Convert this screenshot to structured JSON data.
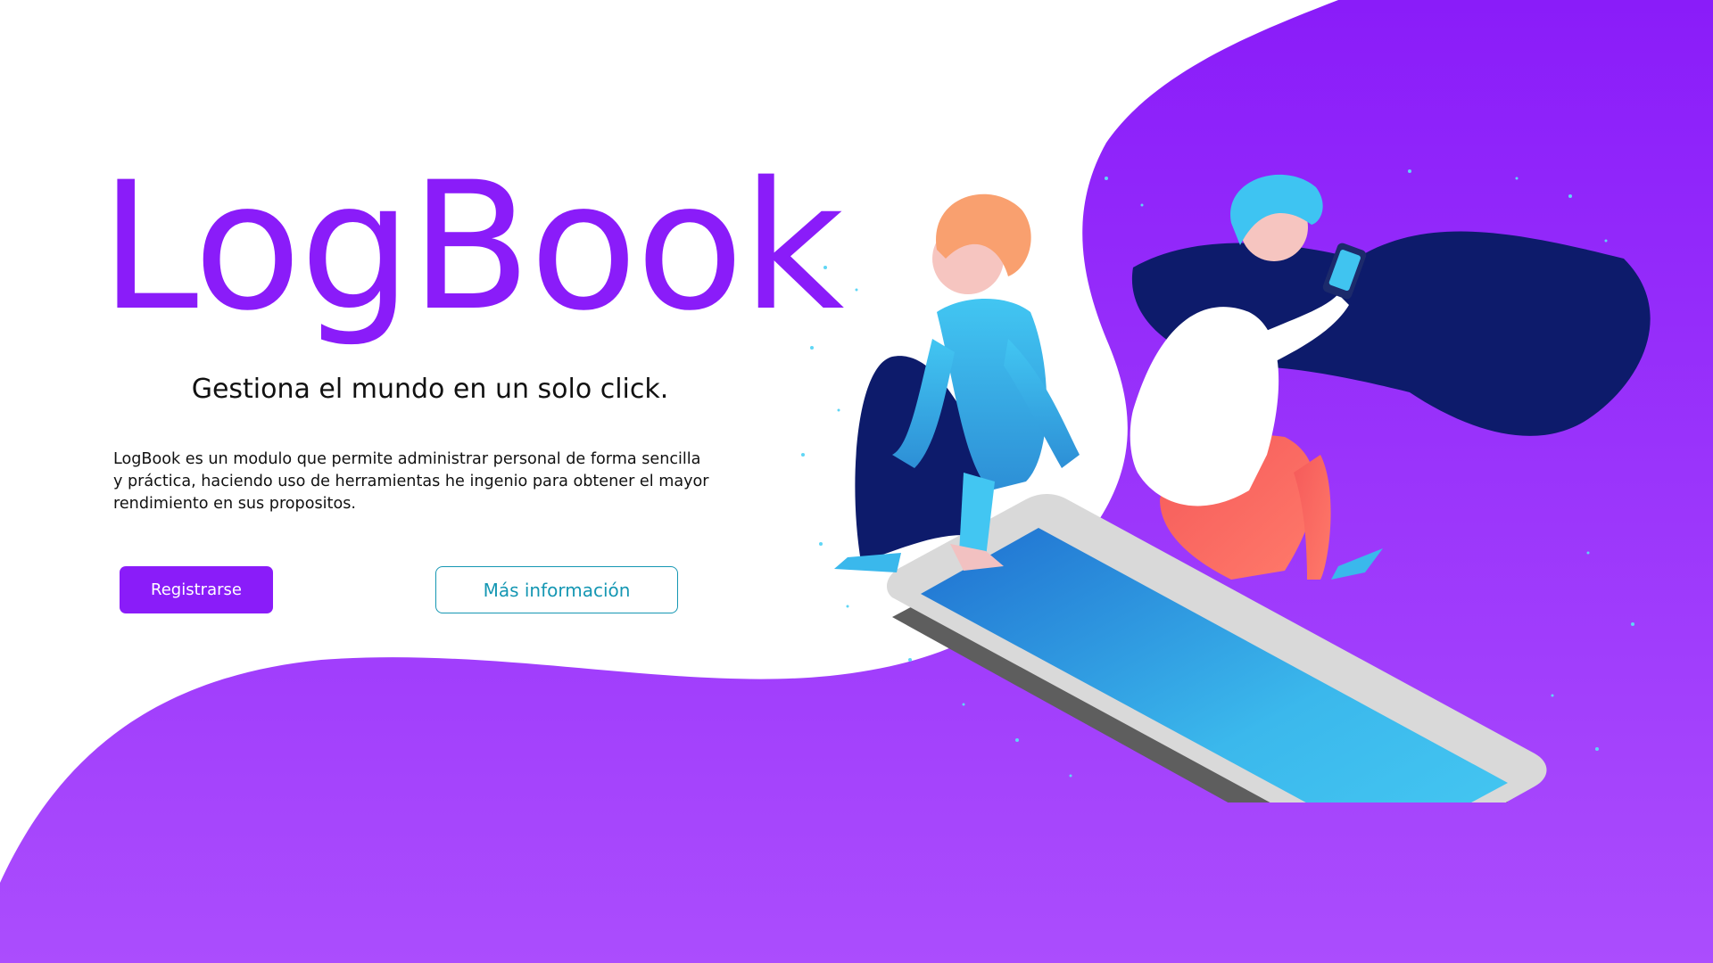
{
  "brand": {
    "title": "LogBook",
    "tagline": "Gestiona el mundo en un solo click.",
    "description_lines": [
      "LogBook es un modulo que permite administrar personal de forma sencilla",
      " y práctica, haciendo uso de herramientas he ingenio para obtener el mayor",
      "rendimiento en sus propositos."
    ]
  },
  "actions": {
    "register_label": "Registrarse",
    "more_info_label": "Más información"
  },
  "colors": {
    "brand_purple": "#8a1cf9",
    "purple_light": "#a64dff",
    "teal_accent": "#1597b3",
    "navy": "#0d1b6b",
    "sky_blue": "#40c4f0",
    "coral": "#f76060"
  },
  "illustration": {
    "subject": "two-people-sitting-on-smartphone"
  }
}
